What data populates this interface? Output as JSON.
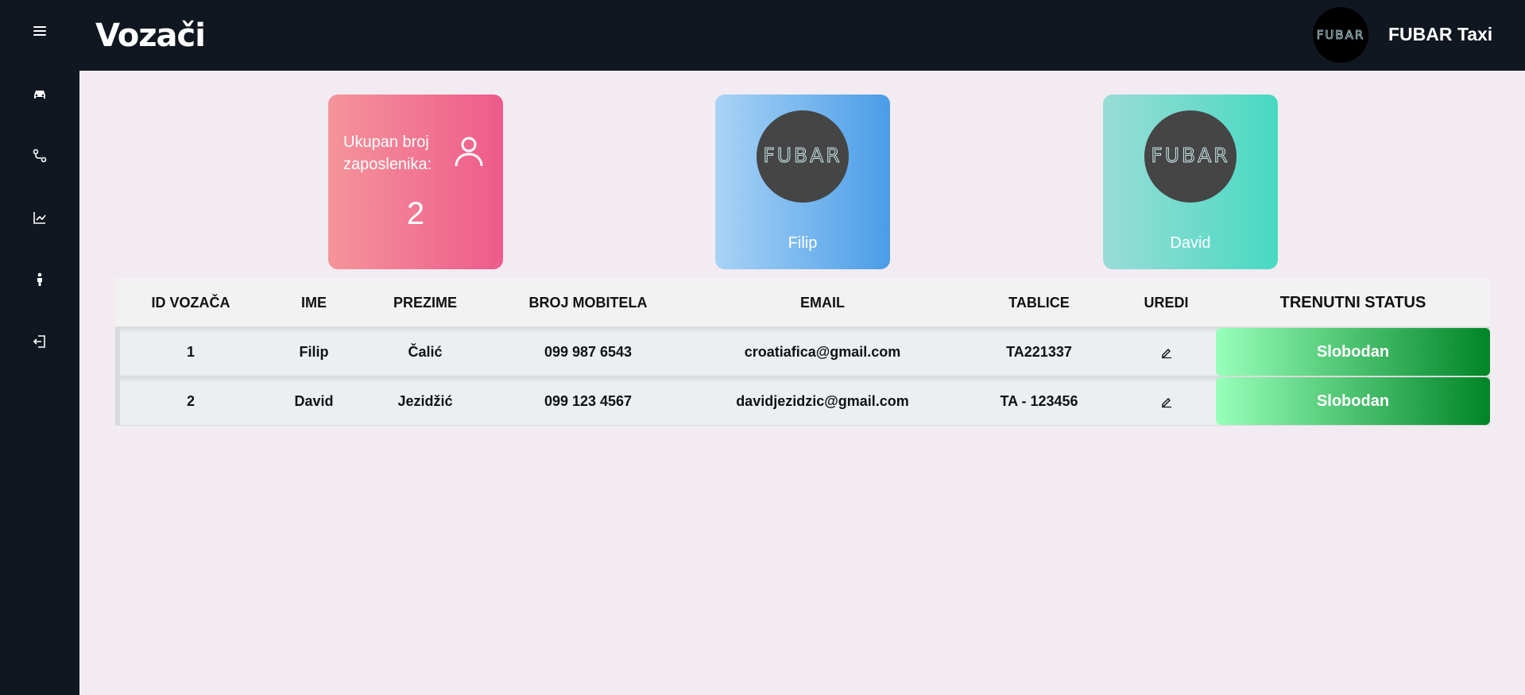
{
  "app": {
    "title": "Vozači",
    "brand_name": "FUBAR Taxi",
    "logo_text": "FUBAR"
  },
  "sidebar": {
    "items": [
      {
        "icon": "menu-icon"
      },
      {
        "icon": "car-icon"
      },
      {
        "icon": "route-icon"
      },
      {
        "icon": "chart-line-icon"
      },
      {
        "icon": "person-icon"
      },
      {
        "icon": "logout-icon"
      }
    ]
  },
  "summary": {
    "total_label": "Ukupan broj zaposlenika:",
    "total_value": "2",
    "drivers": [
      {
        "name": "Filip"
      },
      {
        "name": "David"
      }
    ]
  },
  "table": {
    "headers": [
      "ID VOZAČA",
      "IME",
      "PREZIME",
      "BROJ MOBITELA",
      "EMAIL",
      "TABLICE",
      "UREDI",
      "TRENUTNI STATUS"
    ],
    "rows": [
      {
        "id": "1",
        "first_name": "Filip",
        "last_name": "Čalić",
        "phone": "099 987 6543",
        "email": "croatiafica@gmail.com",
        "plate": "TA221337",
        "status": "Slobodan"
      },
      {
        "id": "2",
        "first_name": "David",
        "last_name": "Jezidžić",
        "phone": "099 123 4567",
        "email": "davidjezidzic@gmail.com",
        "plate": "TA - 123456",
        "status": "Slobodan"
      }
    ]
  },
  "colors": {
    "sidebar_bg": "#111720",
    "page_bg": "#f2ecf2",
    "status_free_start": "#98ffbb",
    "status_free_end": "#008526"
  }
}
